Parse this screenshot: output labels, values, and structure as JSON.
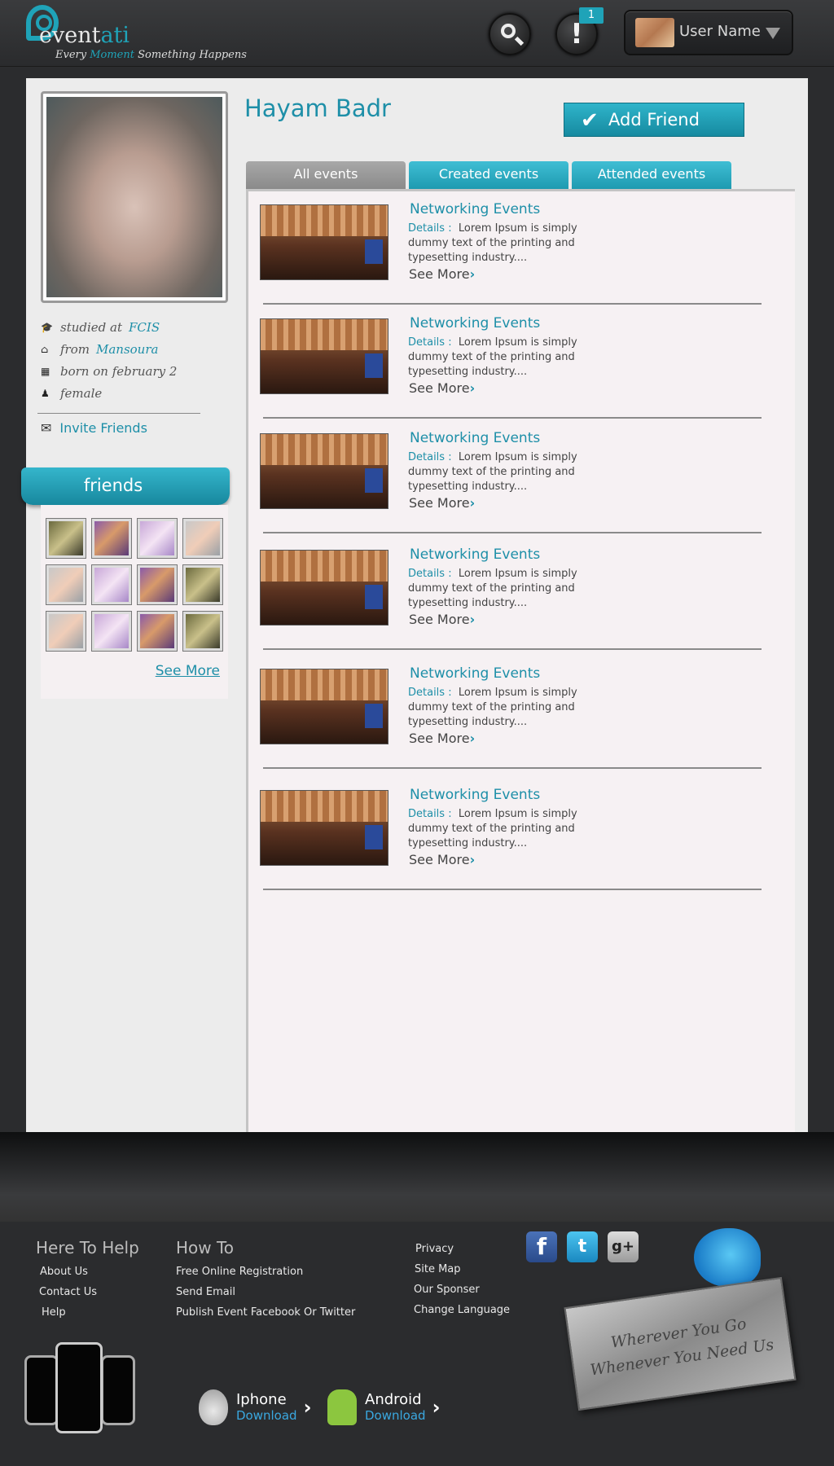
{
  "header": {
    "logo_text_main": "event",
    "logo_text_accent": "ati",
    "tagline_1": "Every ",
    "tagline_accent": "Moment",
    "tagline_2": " Something Happens",
    "notification_count": "1",
    "alert_glyph": "!",
    "user_name": "User Name"
  },
  "profile": {
    "name": "Hayam Badr",
    "add_friend_label": "Add Friend",
    "info": [
      {
        "icon": "graduation-cap-icon",
        "glyph": "🎓",
        "text": "studied at",
        "link": "FCIS"
      },
      {
        "icon": "home-icon",
        "glyph": "⌂",
        "text": "from",
        "link": "Mansoura"
      },
      {
        "icon": "calendar-icon",
        "glyph": "▦",
        "text": "born on february 2",
        "link": ""
      },
      {
        "icon": "person-icon",
        "glyph": "♟",
        "text": "female",
        "link": ""
      }
    ],
    "invite_label": "Invite Friends",
    "friends_title": "friends",
    "friends_see_more": "See More"
  },
  "tabs": [
    "All events",
    "Created events",
    "Attended events"
  ],
  "events": [
    {
      "title": "Networking Events",
      "details_label": "Details :",
      "details": "Lorem Ipsum is simply dummy text of the printing and typesetting industry....",
      "see_more": "See More"
    },
    {
      "title": "Networking Events",
      "details_label": "Details :",
      "details": "Lorem Ipsum is simply dummy text of the printing and typesetting industry....",
      "see_more": "See More"
    },
    {
      "title": "Networking Events",
      "details_label": "Details :",
      "details": "Lorem Ipsum is simply dummy text of the printing and typesetting industry....",
      "see_more": "See More"
    },
    {
      "title": "Networking Events",
      "details_label": "Details :",
      "details": "Lorem Ipsum is simply dummy text of the printing and typesetting industry....",
      "see_more": "See More"
    },
    {
      "title": "Networking Events",
      "details_label": "Details :",
      "details": "Lorem Ipsum is simply dummy text of the printing and typesetting industry....",
      "see_more": "See More"
    },
    {
      "title": "Networking Events",
      "details_label": "Details :",
      "details": "Lorem Ipsum is simply dummy text of the printing and typesetting industry....",
      "see_more": "See More"
    }
  ],
  "footer": {
    "col1": {
      "heading": "Here To Help",
      "links": [
        "About Us",
        "Contact Us",
        "Help"
      ]
    },
    "col2": {
      "heading": "How To",
      "links": [
        "Free Online Registration",
        "Send Email",
        "Publish Event Facebook Or Twitter"
      ]
    },
    "col3": {
      "links": [
        "Privacy",
        "Site Map",
        "Our Sponser",
        "Change Language"
      ]
    },
    "social": [
      "f",
      "t",
      "g+"
    ],
    "sign_line_1": "Wherever You Go",
    "sign_line_2": "Whenever You Need Us",
    "iphone_label": "Iphone",
    "iphone_sub": "Download",
    "android_label": "Android",
    "android_sub": "Download"
  },
  "colors": {
    "accent": "#1e8fa8",
    "tab_active": "#999999",
    "header_bg": "#2a2b2d"
  }
}
